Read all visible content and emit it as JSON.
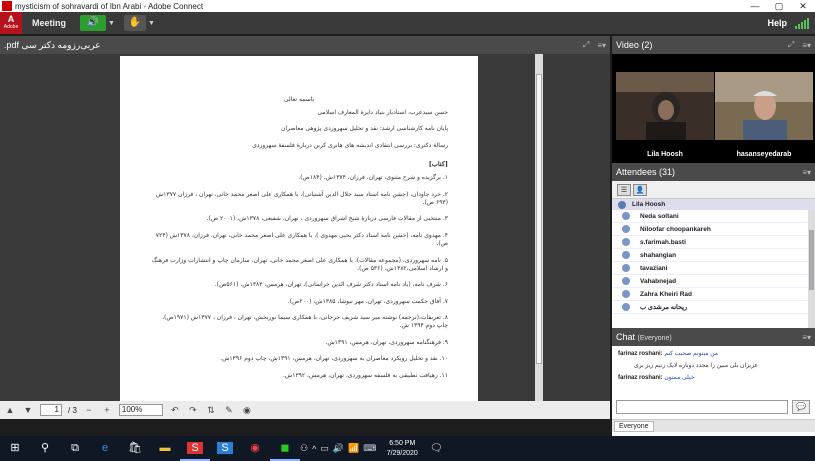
{
  "window": {
    "title": "mysticism of sohravardi of Ibn Arabi - Adobe Connect",
    "min": "—",
    "max": "▢",
    "close": "✕"
  },
  "menubar": {
    "brand": "Adobe",
    "meeting": "Meeting",
    "help": "Help"
  },
  "doc_pod": {
    "title": ".pdf عربی‌رزومه دکتر سی",
    "page_current": "1",
    "page_total": "/ 3",
    "zoom": "100%",
    "content": {
      "header": "باسمه تعالی",
      "lines": [
        "حسن سیدعرب، استادیار بنیاد دایرهٔ المعارف اسلامی",
        "پایان نامه کارشناسی ارشد: نقد و تحلیل سهروردی پژوهی معاصران",
        "رسالهٔ دکتری: بررسی انتقادی اندیشه های هانری کربن دربارهٔ فلسفهٔ سهروردی"
      ],
      "section": "[کتاب]",
      "items": [
        "١. برگزیده و شرح مثنوی، تهران، فرزان، ١٣٧۴ش، (١٨۴ص).",
        "٢. خرد جاودان، (جشن نامه استاد سید جلال الدین آشتیانی)، با همکاری علی اصغر محمد خانی، تهران ، فرزان ١٣٧٧ش (۶٩٣ ص).",
        "٣. منتخبی از مقالات فارسی دربارهٔ شیخ اشراق سهروردی ، تهران، شفیعی، ١٣٧٨ش، (٢٠٠١ ص).",
        "۴. مهدوی نامه، (جشن نامه استاد دکتر یحیی مهدوی )، با همکاری علی اصغر محمد خانی، تهران، فرزان، ١٣٧٨ش (٧٢۴ ص).",
        "۵. نامه سهروردی، (مجموعه مقالات)، با همکاری علی اصغر محمد خانی، تهران، سازمان چاپ و انتشارات وزارت فرهنگ و ارشاد اسلامی،١٣٨٢ش، (۵٣۶ ص).",
        "۶. شرف نامه، (یاد نامه استاد دکتر شرف الدین خراسانی)، تهران، هرمس، ١٣٨٣ش، (۵۶١ص).",
        "٧. آفاق حکمت سهروردی، تهران، مهر نیوشا، ١٣٨۵ش، (٢٠٠ص).",
        "٨. تعریفات،(ترجمه) نوشته میر سید شریف جرجانی، با همکاری سیما نوربخش، تهران ، فرزان ، ١٣٧٧ش (١٩٧١ص)، چاپ دوم ١٣٩۴ ش.",
        "٩. فرهنگنامه سهروردی، تهران، هرمس، ١٣٩١ش.",
        "١٠. نقد و تحلیل رویکرد معاصران به سهروردی، تهران، هرمس، ١٣٩١ش، چاپ دوم ١٣٩۶ش.",
        "١١. رهیافت تطبیقی به فلسفه سهروردی، تهران، هرمس، ١٣٩٢ش."
      ]
    }
  },
  "video_pod": {
    "title": "Video",
    "count": "(2)",
    "participants": [
      "Lila Hoosh",
      "hasanseyedarab"
    ]
  },
  "attendees_pod": {
    "title": "Attendees",
    "count": "(31)",
    "host": "Lila Hoosh",
    "list": [
      "Neda soltani",
      "Niloofar choopankareh",
      "s.farimah.basti",
      "shahangian",
      "tavaziani",
      "Vahabnejad",
      "Zahra Kheiri Rad",
      "ریحانه‌ مرشدی ب"
    ]
  },
  "chat_pod": {
    "title": "Chat",
    "scope": "(Everyone)",
    "messages": [
      {
        "from": "farinaz roshani:",
        "text": "من میتونم صحبت کنم"
      },
      {
        "from": "",
        "text": "عزیزان بلی    مبین    را مجدد    دوباره لایک زنیم ریز بزی"
      },
      {
        "from": "farinaz roshani:",
        "text": "خیلی ممنون"
      }
    ],
    "tab": "Everyone"
  },
  "taskbar": {
    "time": "6:50 PM",
    "date": "7/29/2020"
  },
  "colors": {
    "speaker_on": "#2d9e2d",
    "brand": "#b5121b",
    "link": "#1b46b8"
  }
}
